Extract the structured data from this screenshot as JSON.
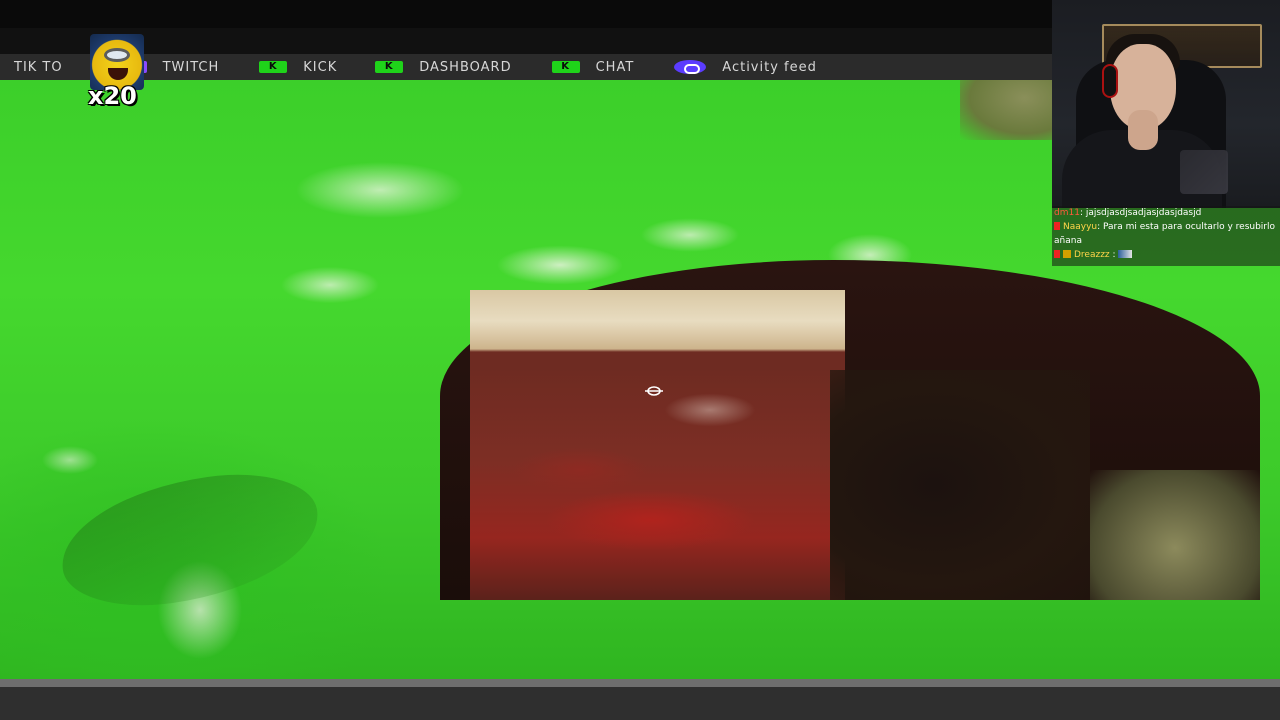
{
  "nav": {
    "items": [
      {
        "label": "TIK TO",
        "icon": "tiktok-icon"
      },
      {
        "label": "TWITCH",
        "icon": "twitch-icon"
      },
      {
        "label": "KICK",
        "icon": "kick-icon"
      },
      {
        "label": "DASHBOARD",
        "icon": "kick-icon"
      },
      {
        "label": "CHAT",
        "icon": "kick-icon"
      },
      {
        "label": "Activity feed",
        "icon": "activity-icon"
      }
    ]
  },
  "sticker": {
    "count": "x20",
    "icon": "minion-emote-icon"
  },
  "chat": {
    "messages": [
      {
        "user": "dm11",
        "text": ": jajsdjasdjsadjasjdasjdasjd"
      },
      {
        "user": "Naayyu",
        "text": ": Para mi esta para ocultarlo y resubirlo"
      },
      {
        "user": "",
        "text": "añana"
      },
      {
        "user": "Dreazzz",
        "text": " :"
      }
    ]
  },
  "colors": {
    "kick_green": "#1fd31a",
    "twitch_purple": "#8a4bff",
    "nav_bg": "#2b2b2b",
    "game_green": "#45d82e"
  }
}
